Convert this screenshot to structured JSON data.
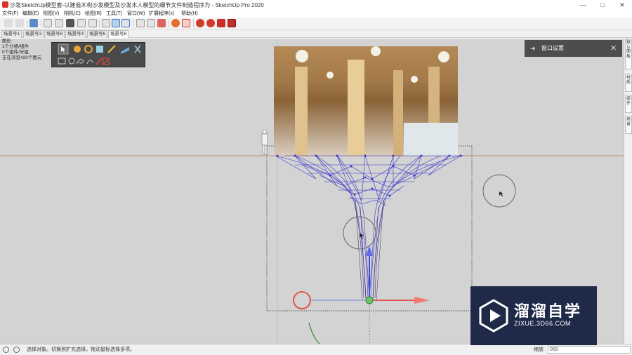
{
  "window": {
    "title": "沙发SketchUp模型套-以建造木构沙发模型及沙发木人模型的细节文件制造程序为 - SketchUp Pro 2020",
    "controls": [
      "—",
      "□",
      "✕"
    ]
  },
  "menu": [
    "文件(F)",
    "编辑(E)",
    "视图(V)",
    "相机(C)",
    "绘图(R)",
    "工具(T)",
    "窗口(W)",
    "扩展程序(x)",
    "帮助(H)"
  ],
  "scenes": [
    "场景号1",
    "场景号3",
    "场景号8",
    "场景号4",
    "场景号6",
    "场景号8"
  ],
  "active_scene_index": 5,
  "stats": {
    "heading": "图形",
    "line1": "1个分组/组件",
    "line2": "0个组件/分组",
    "line3": "正在浏览420个图元"
  },
  "palette": {
    "icons": [
      "select-arrow-icon",
      "move-icon",
      "rotate-icon",
      "paint-bucket-icon",
      "magic-wand-icon",
      "section-plane-icon",
      "axes-icon",
      "rectangle-select-icon",
      "circle-select-icon",
      "lasso-select-icon",
      "freehand-select-icon",
      "line-red-icon",
      "eraser-red-icon"
    ]
  },
  "panel": {
    "title": "窗口设置",
    "close": "✕",
    "arrow": "➜"
  },
  "right_tray": [
    "默认面板",
    "材质",
    "组件",
    "场景"
  ],
  "status": {
    "text": "选择对象。切换到扩充选择。拖动鼠标选择多项。",
    "measure_label": "缩放",
    "measure_value": "055"
  },
  "watermark": {
    "name": "溜溜自学",
    "url": "ZIXUE.3D66.COM"
  },
  "colors": {
    "viewport_bg": "#d3d3d3",
    "panel_bg": "#4d4d4d",
    "axis_red": "#e2574c",
    "axis_blue": "#3a4fd6",
    "axis_green": "#2e8a2e",
    "mesh_blue": "#3a35c8",
    "watermark_bg": "#1f2a48"
  }
}
